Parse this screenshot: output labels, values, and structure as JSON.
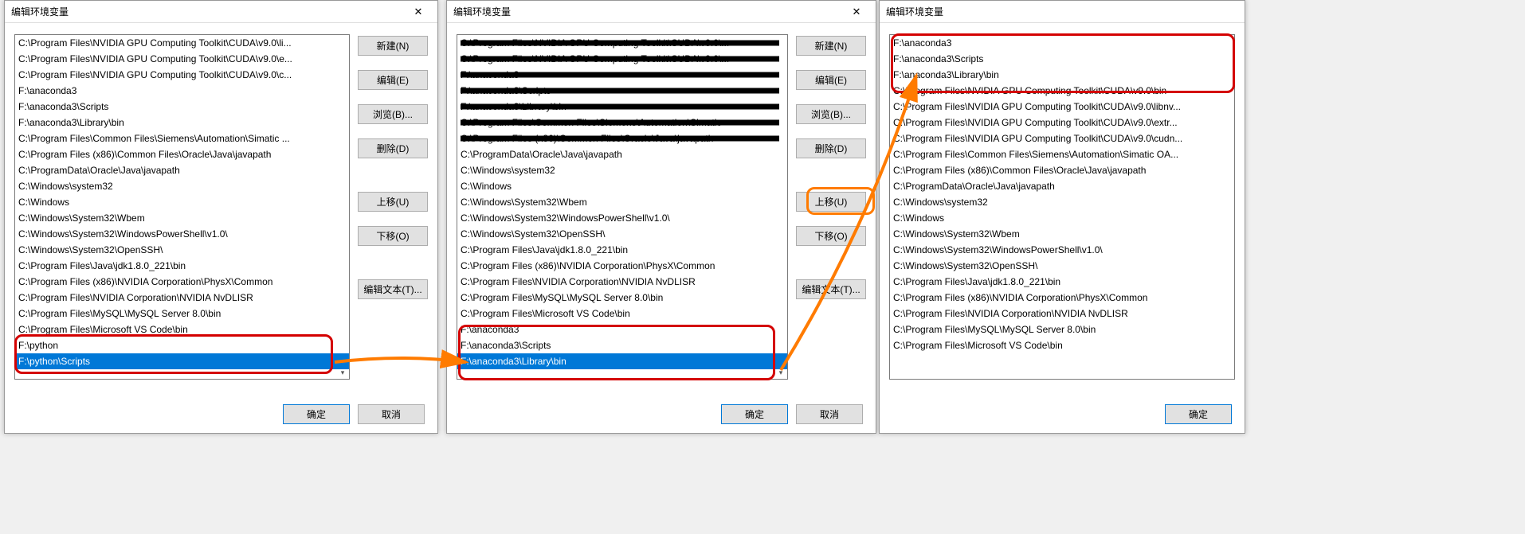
{
  "dialog_title": "编辑环境变量",
  "buttons": {
    "new": "新建(N)",
    "edit": "编辑(E)",
    "browse": "浏览(B)...",
    "delete": "删除(D)",
    "move_up": "上移(U)",
    "move_down": "下移(O)",
    "edit_text": "编辑文本(T)...",
    "ok": "确定",
    "cancel": "取消"
  },
  "list1": [
    "C:\\Program Files\\NVIDIA GPU Computing Toolkit\\CUDA\\v9.0\\li...",
    "C:\\Program Files\\NVIDIA GPU Computing Toolkit\\CUDA\\v9.0\\e...",
    "C:\\Program Files\\NVIDIA GPU Computing Toolkit\\CUDA\\v9.0\\c...",
    "F:\\anaconda3",
    "F:\\anaconda3\\Scripts",
    "F:\\anaconda3\\Library\\bin",
    "C:\\Program Files\\Common Files\\Siemens\\Automation\\Simatic ...",
    "C:\\Program Files (x86)\\Common Files\\Oracle\\Java\\javapath",
    "C:\\ProgramData\\Oracle\\Java\\javapath",
    "C:\\Windows\\system32",
    "C:\\Windows",
    "C:\\Windows\\System32\\Wbem",
    "C:\\Windows\\System32\\WindowsPowerShell\\v1.0\\",
    "C:\\Windows\\System32\\OpenSSH\\",
    "C:\\Program Files\\Java\\jdk1.8.0_221\\bin",
    "C:\\Program Files (x86)\\NVIDIA Corporation\\PhysX\\Common",
    "C:\\Program Files\\NVIDIA Corporation\\NVIDIA NvDLISR",
    "C:\\Program Files\\MySQL\\MySQL Server 8.0\\bin",
    "C:\\Program Files\\Microsoft VS Code\\bin",
    "F:\\python",
    "F:\\python\\Scripts"
  ],
  "list1_selected": 20,
  "list2": [
    "C:\\Program Files\\NVIDIA GPU Computing Toolkit\\CUDA\\v9.0\\...",
    "C:\\Program Files\\NVIDIA GPU Computing Toolkit\\CUDA\\v9.0\\...",
    "F:\\anaconda3",
    "F:\\anaconda3\\Scripts",
    "F:\\anaconda3\\Library\\bin",
    "C:\\Program Files\\Common Files\\Siemens\\Automation\\Simatic",
    "C:\\Program Files (x86)\\Common Files\\Oracle\\Java\\javapath",
    "C:\\ProgramData\\Oracle\\Java\\javapath",
    "C:\\Windows\\system32",
    "C:\\Windows",
    "C:\\Windows\\System32\\Wbem",
    "C:\\Windows\\System32\\WindowsPowerShell\\v1.0\\",
    "C:\\Windows\\System32\\OpenSSH\\",
    "C:\\Program Files\\Java\\jdk1.8.0_221\\bin",
    "C:\\Program Files (x86)\\NVIDIA Corporation\\PhysX\\Common",
    "C:\\Program Files\\NVIDIA Corporation\\NVIDIA NvDLISR",
    "C:\\Program Files\\MySQL\\MySQL Server 8.0\\bin",
    "C:\\Program Files\\Microsoft VS Code\\bin",
    "F:\\anaconda3",
    "F:\\anaconda3\\Scripts",
    "F:\\anaconda3\\Library\\bin"
  ],
  "list2_selected": 20,
  "list2_redacted": [
    0,
    1,
    2,
    3,
    4,
    5,
    6
  ],
  "list3": [
    "F:\\anaconda3",
    "F:\\anaconda3\\Scripts",
    "F:\\anaconda3\\Library\\bin",
    "C:\\Program Files\\NVIDIA GPU Computing Toolkit\\CUDA\\v9.0\\bin",
    "C:\\Program Files\\NVIDIA GPU Computing Toolkit\\CUDA\\v9.0\\libnv...",
    "C:\\Program Files\\NVIDIA GPU Computing Toolkit\\CUDA\\v9.0\\extr...",
    "C:\\Program Files\\NVIDIA GPU Computing Toolkit\\CUDA\\v9.0\\cudn...",
    "C:\\Program Files\\Common Files\\Siemens\\Automation\\Simatic OA...",
    "C:\\Program Files (x86)\\Common Files\\Oracle\\Java\\javapath",
    "C:\\ProgramData\\Oracle\\Java\\javapath",
    "C:\\Windows\\system32",
    "C:\\Windows",
    "C:\\Windows\\System32\\Wbem",
    "C:\\Windows\\System32\\WindowsPowerShell\\v1.0\\",
    "C:\\Windows\\System32\\OpenSSH\\",
    "C:\\Program Files\\Java\\jdk1.8.0_221\\bin",
    "C:\\Program Files (x86)\\NVIDIA Corporation\\PhysX\\Common",
    "C:\\Program Files\\NVIDIA Corporation\\NVIDIA NvDLISR",
    "C:\\Program Files\\MySQL\\MySQL Server 8.0\\bin",
    "C:\\Program Files\\Microsoft VS Code\\bin"
  ]
}
